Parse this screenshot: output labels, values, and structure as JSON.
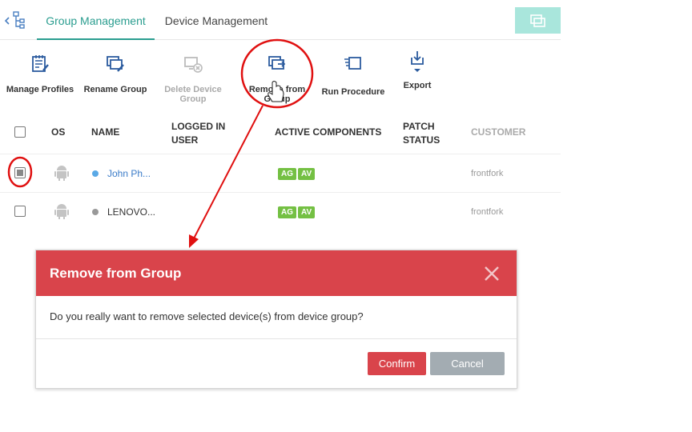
{
  "tabs": [
    {
      "label": "Group Management",
      "active": true
    },
    {
      "label": "Device Management",
      "active": false
    }
  ],
  "toolbar": {
    "manage_profiles": "Manage Profiles",
    "rename_group": "Rename Group",
    "delete_device_group": [
      "Delete Device",
      "Group"
    ],
    "remove_from_group": [
      "Remove from",
      "Group"
    ],
    "run_procedure": "Run Procedure",
    "export": "Export"
  },
  "table": {
    "headers": {
      "os": "OS",
      "name": "NAME",
      "logged_in_user": [
        "LOGGED IN",
        "USER"
      ],
      "active_components": "ACTIVE COMPONENTS",
      "patch_status": [
        "PATCH",
        "STATUS"
      ],
      "customer": "CUSTOMER"
    },
    "rows": [
      {
        "checked": true,
        "os": "android-icon",
        "status_color": "#5aa9e6",
        "name": "John Ph...",
        "name_color": "#3a7bc8",
        "components": [
          "AG",
          "AV"
        ],
        "customer": "frontfork"
      },
      {
        "checked": false,
        "os": "android-icon",
        "status_color": "#999999",
        "name": "LENOVO...",
        "name_color": "#333333",
        "components": [
          "AG",
          "AV"
        ],
        "customer": "frontfork"
      }
    ]
  },
  "modal": {
    "title": "Remove from Group",
    "message": "Do you really want to remove selected device(s) from device group?",
    "confirm_label": "Confirm",
    "cancel_label": "Cancel"
  },
  "colors": {
    "accent": "#2a9d8f",
    "danger": "#d9444b",
    "badge_green": "#74c043",
    "annotation_red": "#e01010"
  }
}
